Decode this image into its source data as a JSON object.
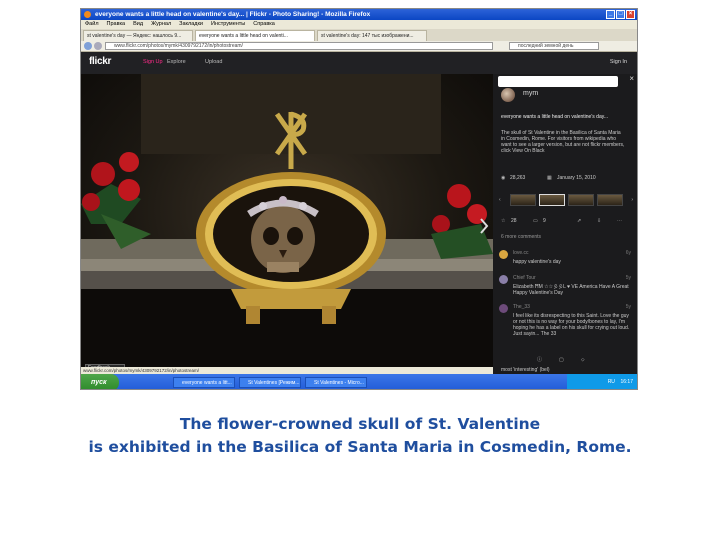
{
  "browser": {
    "title": "everyone wants a little head on valentine's day... | Flickr - Photo Sharing! - Mozilla Firefox",
    "menu": [
      "Файл",
      "Правка",
      "Вид",
      "Журнал",
      "Закладки",
      "Инструменты",
      "Справка"
    ],
    "tabs": [
      {
        "label": "st valentine's day — Яндекс: нашлось 9..."
      },
      {
        "label": "everyone wants a little head on valenti...",
        "active": true
      },
      {
        "label": "st valentine's day: 147 тыс изображени..."
      }
    ],
    "url": "www.flickr.com/photos/mymk/4309792172/in/photostream/",
    "search": "последний земной день"
  },
  "flickr": {
    "logo": "flickr",
    "nav": [
      "Sign Up",
      "Explore",
      "Upload"
    ],
    "sign_in": "Sign In",
    "feedback": "Feedback",
    "status_url": "www.flickr.com/photos/mymk/4309792172/in/photostream/",
    "panel": {
      "author": "mym",
      "title": "everyone wants a little head on valentine's day...",
      "description": "The skull of St Valentine in the Basilica of Santa Maria in Cosmedin, Rome. For visitors from wikipedia who want to see a larger version, but are not flickr members, click View On Black",
      "views": "28,263",
      "date": "January 15, 2010",
      "faves": "28",
      "comments": "9",
      "more_comments": "6 more comments",
      "comment_list": [
        {
          "author": "love.cc",
          "time": "6y",
          "text": "happy valentine's day"
        },
        {
          "author": "Chief Tour",
          "time": "5y",
          "text": "Elizabeth ĦM ☆☆彡彡L ♥ VE America Have A Great Happy Valentine's Day"
        },
        {
          "author": "The_33",
          "time": "5y",
          "text": "I feel like its disrespecting to this Saint. Love the guy or not this is no way for your body/bones to lay, I'm hoping he has a label on his skull for crying out loud. Just sayin... The 33"
        }
      ],
      "footer": "most 'interesting' (bel)"
    }
  },
  "taskbar": {
    "start": "пуск",
    "tasks": [
      "everyone wants a litt...",
      "St Valentines [Режим...",
      "St Valentines - Micro..."
    ],
    "lang": "RU",
    "time": "16:17"
  },
  "caption": {
    "line1": "The flower-crowned skull of St. Valentine",
    "line2": "is exhibited in the Basilica of Santa Maria in Cosmedin, Rome."
  }
}
